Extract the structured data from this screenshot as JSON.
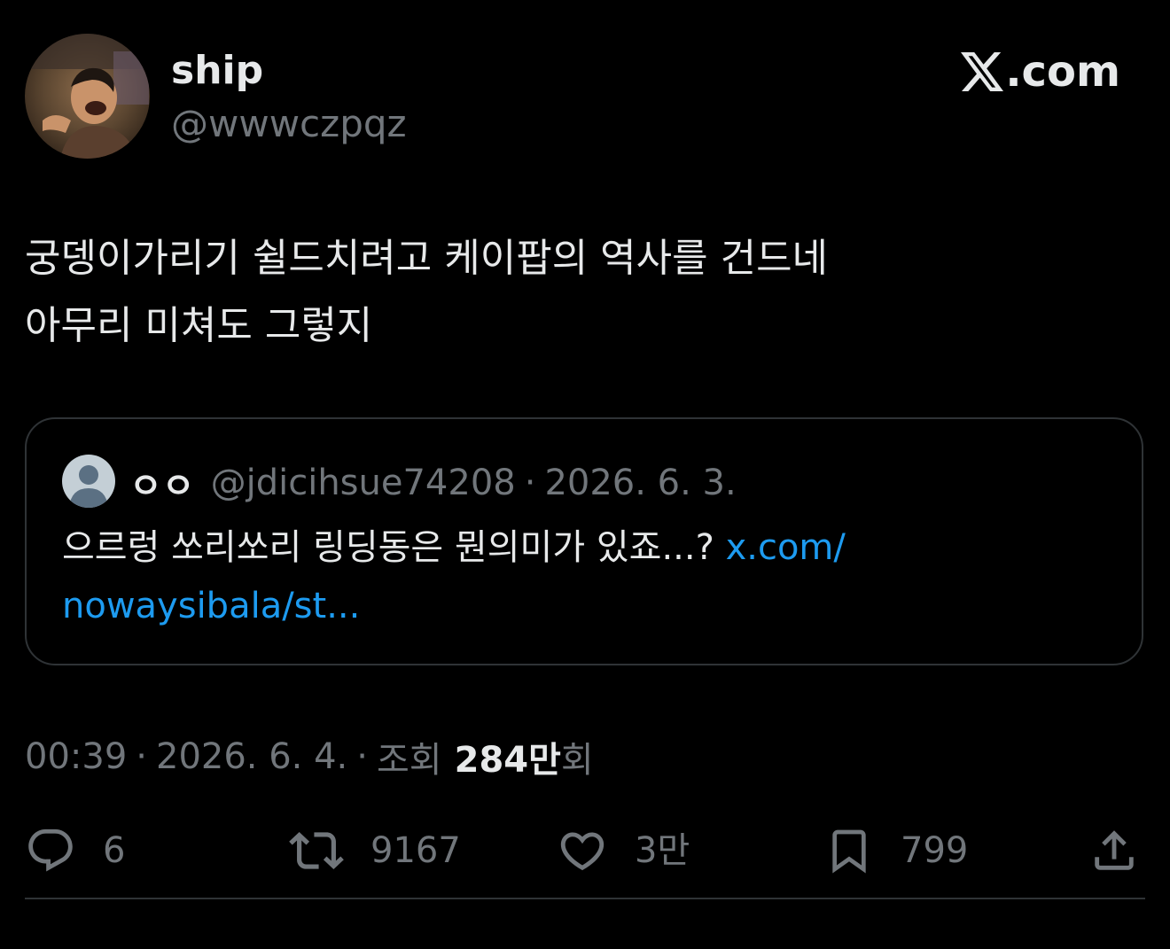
{
  "author": {
    "display_name": "ship",
    "handle": "@wwwczpqz"
  },
  "brand": {
    "logo_icon": "x-logo-icon",
    "suffix": ".com"
  },
  "tweet": {
    "lines": [
      "궁뎅이가리기 쉴드치려고 케이팝의 역사를 건드네",
      "아무리 미쳐도 그렇지"
    ]
  },
  "quote": {
    "name": "ㅇㅇ",
    "handle": "@jdicihsue74208",
    "separator": "·",
    "date": "2026. 6. 3.",
    "text_line1": "으르렁 쏘리쏘리 링딩동은 뭔의미가 있죠...? ",
    "link_part1": "x.com/",
    "link_part2": "nowaysibala/st..."
  },
  "meta": {
    "time": "00:39",
    "separator": "·",
    "date": "2026. 6. 4.",
    "views_label": "조회",
    "views_count": "284만",
    "views_suffix": "회"
  },
  "actions": {
    "reply": {
      "icon": "reply-icon",
      "count": "6"
    },
    "retweet": {
      "icon": "retweet-icon",
      "count": "9167"
    },
    "like": {
      "icon": "heart-icon",
      "count": "3만"
    },
    "bookmark": {
      "icon": "bookmark-icon",
      "count": "799"
    },
    "share": {
      "icon": "share-icon"
    }
  },
  "colors": {
    "background": "#000000",
    "text_primary": "#e7e9ea",
    "text_secondary": "#71767b",
    "link": "#1d9bf0",
    "border": "#2f3336"
  }
}
